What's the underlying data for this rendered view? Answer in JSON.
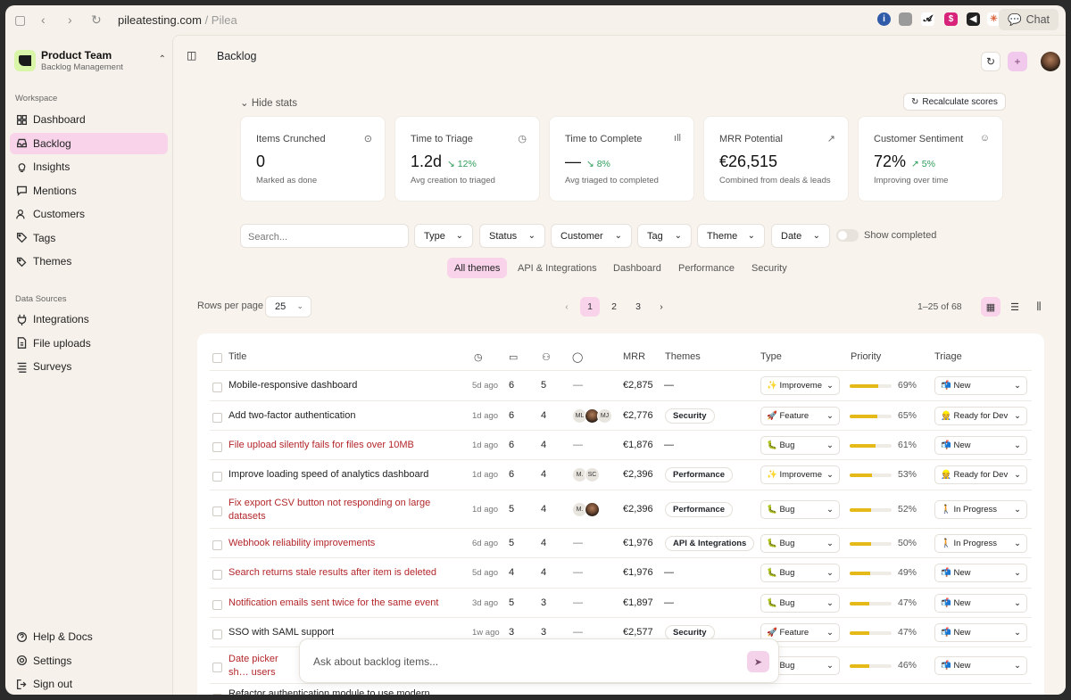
{
  "browser": {
    "url_host": "pileatesting.com",
    "url_sep": " / ",
    "url_page": "Pilea",
    "chat_label": "Chat"
  },
  "team": {
    "name": "Product Team",
    "sub": "Backlog Management"
  },
  "sidebar": {
    "workspace_label": "Workspace",
    "workspace": [
      {
        "label": "Dashboard",
        "icon": "dashboard-icon"
      },
      {
        "label": "Backlog",
        "icon": "inbox-icon",
        "active": true
      },
      {
        "label": "Insights",
        "icon": "lightbulb-icon"
      },
      {
        "label": "Mentions",
        "icon": "chat-icon"
      },
      {
        "label": "Customers",
        "icon": "users-icon"
      },
      {
        "label": "Tags",
        "icon": "tag-icon"
      },
      {
        "label": "Themes",
        "icon": "tags-icon"
      }
    ],
    "sources_label": "Data Sources",
    "sources": [
      {
        "label": "Integrations",
        "icon": "plug-icon"
      },
      {
        "label": "File uploads",
        "icon": "file-icon"
      },
      {
        "label": "Surveys",
        "icon": "list-icon"
      }
    ],
    "bottom": [
      {
        "label": "Help & Docs",
        "icon": "help-icon"
      },
      {
        "label": "Settings",
        "icon": "gear-icon"
      },
      {
        "label": "Sign out",
        "icon": "signout-icon"
      }
    ]
  },
  "header": {
    "title": "Backlog"
  },
  "stats": {
    "hide_label": "Hide stats",
    "recalc_label": "Recalculate scores",
    "cards": [
      {
        "label": "Items Crunched",
        "value": "0",
        "trend": "",
        "sub": "Marked as done"
      },
      {
        "label": "Time to Triage",
        "value": "1.2d",
        "trend": "↘ 12%",
        "sub": "Avg creation to triaged"
      },
      {
        "label": "Time to Complete",
        "value": "—",
        "trend": "↘ 8%",
        "sub": "Avg triaged to completed"
      },
      {
        "label": "MRR Potential",
        "value": "€26,515",
        "trend": "",
        "sub": "Combined from deals & leads"
      },
      {
        "label": "Customer Sentiment",
        "value": "72%",
        "trend": "↗ 5%",
        "sub": "Improving over time"
      }
    ]
  },
  "filters": {
    "search_placeholder": "Search...",
    "items": [
      "Type",
      "Status",
      "Customer",
      "Tag",
      "Theme",
      "Date"
    ],
    "show_completed": "Show completed"
  },
  "theme_tabs": [
    "All themes",
    "API & Integrations",
    "Dashboard",
    "Performance",
    "Security"
  ],
  "pagination": {
    "rows_label": "Rows per page",
    "rows_value": "25",
    "pages": [
      "1",
      "2",
      "3"
    ],
    "current": "1",
    "range": "1–25 of 68"
  },
  "table": {
    "columns": {
      "title": "Title",
      "mrr": "MRR",
      "themes": "Themes",
      "type": "Type",
      "priority": "Priority",
      "triage": "Triage"
    },
    "rows": [
      {
        "title": "Mobile-responsive dashboard",
        "red": false,
        "ago": "5d ago",
        "c1": "6",
        "c2": "5",
        "avatars": [],
        "mrr": "€2,875",
        "theme": "—",
        "type": "✨ Improveme",
        "priority": "69%",
        "pv": 0.69,
        "triage": "📬 New"
      },
      {
        "title": "Add two-factor authentication",
        "red": false,
        "ago": "1d ago",
        "c1": "6",
        "c2": "4",
        "avatars": [
          "ML",
          "",
          "MJ"
        ],
        "mrr": "€2,776",
        "theme": "Security",
        "type": "🚀 Feature",
        "priority": "65%",
        "pv": 0.65,
        "triage": "👷 Ready for Dev"
      },
      {
        "title": "File upload silently fails for files over 10MB",
        "red": true,
        "ago": "1d ago",
        "c1": "6",
        "c2": "4",
        "avatars": [],
        "mrr": "€1,876",
        "theme": "—",
        "type": "🐛 Bug",
        "priority": "61%",
        "pv": 0.61,
        "triage": "📬 New"
      },
      {
        "title": "Improve loading speed of analytics dashboard",
        "red": false,
        "ago": "1d ago",
        "c1": "6",
        "c2": "4",
        "avatars": [
          "M.",
          "SC"
        ],
        "mrr": "€2,396",
        "theme": "Performance",
        "type": "✨ Improveme",
        "priority": "53%",
        "pv": 0.53,
        "triage": "👷 Ready for Dev"
      },
      {
        "title": "Fix export CSV button not responding on large datasets",
        "red": true,
        "ago": "1d ago",
        "c1": "5",
        "c2": "4",
        "avatars": [
          "M.",
          ""
        ],
        "mrr": "€2,396",
        "theme": "Performance",
        "type": "🐛 Bug",
        "priority": "52%",
        "pv": 0.52,
        "triage": "🚶 In Progress"
      },
      {
        "title": "Webhook reliability improvements",
        "red": true,
        "ago": "6d ago",
        "c1": "5",
        "c2": "4",
        "avatars": [],
        "mrr": "€1,976",
        "theme": "API & Integrations",
        "type": "🐛 Bug",
        "priority": "50%",
        "pv": 0.5,
        "triage": "🚶 In Progress"
      },
      {
        "title": "Search returns stale results after item is deleted",
        "red": true,
        "ago": "5d ago",
        "c1": "4",
        "c2": "4",
        "avatars": [],
        "mrr": "€1,976",
        "theme": "—",
        "type": "🐛 Bug",
        "priority": "49%",
        "pv": 0.49,
        "triage": "📬 New"
      },
      {
        "title": "Notification emails sent twice for the same event",
        "red": true,
        "ago": "3d ago",
        "c1": "5",
        "c2": "3",
        "avatars": [],
        "mrr": "€1,897",
        "theme": "—",
        "type": "🐛 Bug",
        "priority": "47%",
        "pv": 0.47,
        "triage": "📬 New"
      },
      {
        "title": "SSO with SAML support",
        "red": false,
        "ago": "1w ago",
        "c1": "3",
        "c2": "3",
        "avatars": [],
        "mrr": "€2,577",
        "theme": "Security",
        "type": "🚀 Feature",
        "priority": "47%",
        "pv": 0.47,
        "triage": "📬 New"
      },
      {
        "title": "Date picker sh… users",
        "red": true,
        "ago": "",
        "c1": "",
        "c2": "",
        "avatars": [],
        "mrr": "",
        "theme": "",
        "type": "🐛 Bug",
        "priority": "46%",
        "pv": 0.46,
        "triage": "📬 New"
      },
      {
        "title": "Refactor authentication module to use modern",
        "red": false,
        "ago": "",
        "c1": "",
        "c2": "",
        "avatars": [],
        "mrr": "",
        "theme": "",
        "type": "",
        "priority": "",
        "pv": 0,
        "triage": ""
      }
    ]
  },
  "chat": {
    "placeholder": "Ask about backlog items..."
  }
}
